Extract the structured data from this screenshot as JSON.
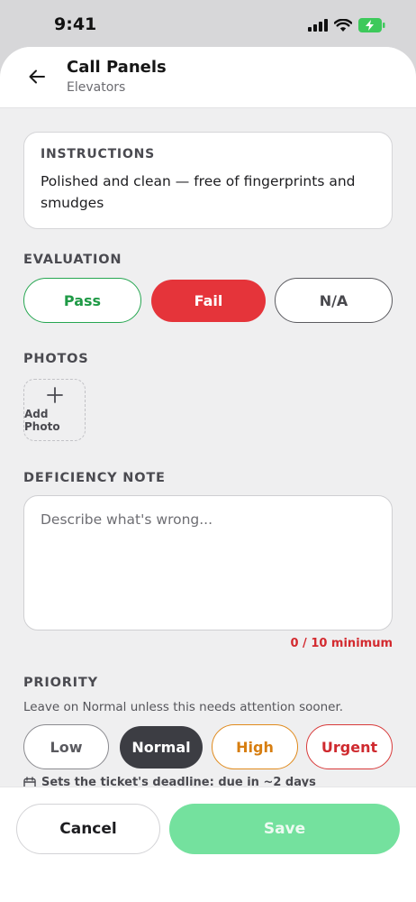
{
  "status_bar": {
    "time": "9:41"
  },
  "header": {
    "title": "Call Panels",
    "subtitle": "Elevators"
  },
  "instructions": {
    "label": "INSTRUCTIONS",
    "text": "Polished and clean — free of fingerprints and smudges"
  },
  "evaluation": {
    "label": "EVALUATION",
    "options": [
      "Pass",
      "Fail",
      "N/A"
    ],
    "selected": "Fail"
  },
  "photos": {
    "label": "PHOTOS",
    "add_label": "Add Photo"
  },
  "deficiency_note": {
    "label": "DEFICIENCY NOTE",
    "placeholder": "Describe what's wrong...",
    "value": "",
    "counter": "0 / 10 minimum"
  },
  "priority": {
    "label": "PRIORITY",
    "help": "Leave on Normal unless this needs attention sooner.",
    "options": [
      "Low",
      "Normal",
      "High",
      "Urgent"
    ],
    "selected": "Normal",
    "deadline_note": "Sets the ticket's deadline: due in ~2 days"
  },
  "footer": {
    "cancel_label": "Cancel",
    "save_label": "Save"
  },
  "colors": {
    "pass": "#1f9a46",
    "fail": "#e5343a",
    "high": "#d77e10",
    "urgent": "#cf2a2f",
    "save": "#74e19e",
    "normal_selected": "#3c3d43"
  }
}
